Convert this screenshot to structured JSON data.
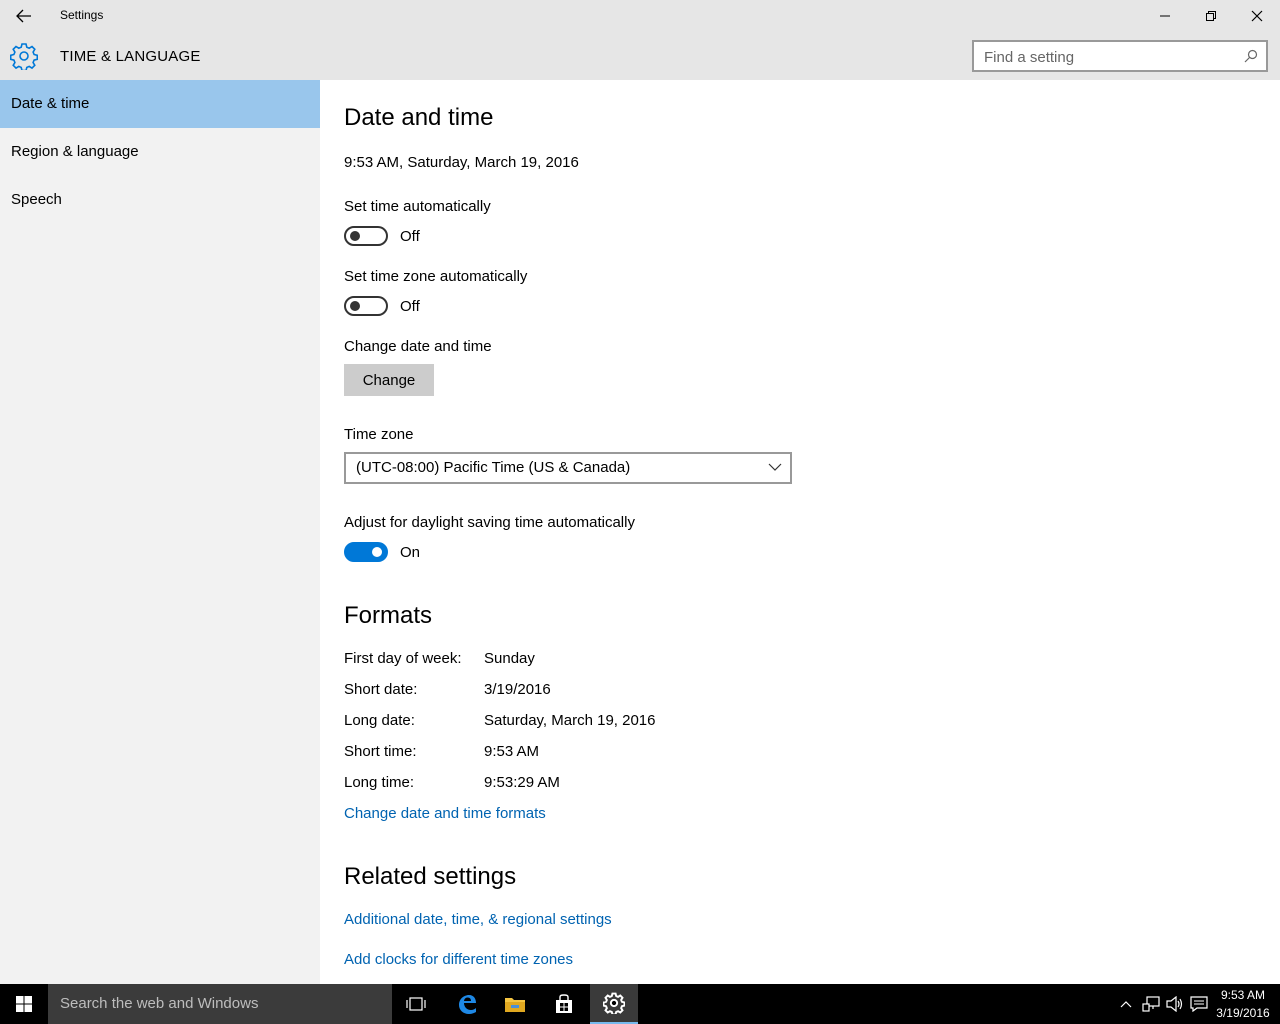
{
  "window": {
    "title": "Settings"
  },
  "header": {
    "title": "TIME & LANGUAGE",
    "search_placeholder": "Find a setting"
  },
  "sidebar": {
    "items": [
      {
        "label": "Date & time"
      },
      {
        "label": "Region & language"
      },
      {
        "label": "Speech"
      }
    ]
  },
  "main": {
    "heading": "Date and time",
    "current_datetime": "9:53 AM, Saturday, March 19, 2016",
    "set_time_auto": {
      "label": "Set time automatically",
      "state": "Off"
    },
    "set_timezone_auto": {
      "label": "Set time zone automatically",
      "state": "Off"
    },
    "change_datetime": {
      "label": "Change date and time",
      "button": "Change"
    },
    "timezone": {
      "label": "Time zone",
      "value": "(UTC-08:00) Pacific Time (US & Canada)"
    },
    "dst": {
      "label": "Adjust for daylight saving time automatically",
      "state": "On"
    },
    "formats": {
      "heading": "Formats",
      "rows": [
        {
          "label": "First day of week:",
          "value": "Sunday"
        },
        {
          "label": "Short date:",
          "value": "3/19/2016"
        },
        {
          "label": "Long date:",
          "value": "Saturday, March 19, 2016"
        },
        {
          "label": "Short time:",
          "value": "9:53 AM"
        },
        {
          "label": "Long time:",
          "value": "9:53:29 AM"
        }
      ],
      "link": "Change date and time formats"
    },
    "related": {
      "heading": "Related settings",
      "links": [
        "Additional date, time, & regional settings",
        "Add clocks for different time zones"
      ]
    }
  },
  "taskbar": {
    "search_placeholder": "Search the web and Windows",
    "clock_time": "9:53 AM",
    "clock_date": "3/19/2016",
    "icons": [
      "task-view-icon",
      "edge-icon",
      "file-explorer-icon",
      "store-icon",
      "settings-icon"
    ]
  },
  "colors": {
    "accent": "#0078d7",
    "link": "#0063b1",
    "sidebar_active": "#99c6ec"
  }
}
